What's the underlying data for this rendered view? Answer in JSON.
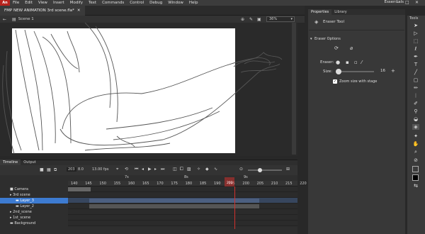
{
  "menu": {
    "logo": "An",
    "items": [
      "File",
      "Edit",
      "View",
      "Insert",
      "Modify",
      "Text",
      "Commands",
      "Control",
      "Debug",
      "Window",
      "Help"
    ],
    "workspace": "Essentials"
  },
  "document": {
    "tab": "FMP NEW ANIMATION 3rd scene.fla*",
    "scene": "Scene 1",
    "zoom": "36%"
  },
  "timeline": {
    "tabs": [
      "Timeline",
      "Output"
    ],
    "fps": "13.00 fps",
    "frame": "203",
    "time": "8.0",
    "ruler": [
      "140",
      "145",
      "150",
      "155",
      "160",
      "165",
      "170",
      "175",
      "180",
      "185",
      "190",
      "195",
      "200",
      "205",
      "210",
      "215",
      "220"
    ],
    "seconds": [
      "7s",
      "8s",
      "9s"
    ],
    "playhead": "203",
    "layers": [
      {
        "name": "Camera",
        "type": "camera"
      },
      {
        "name": "3rd scene",
        "type": "folder"
      },
      {
        "name": "Layer_3",
        "type": "layer",
        "selected": true
      },
      {
        "name": "Layer_2",
        "type": "layer"
      },
      {
        "name": "2nd_scene",
        "type": "folder"
      },
      {
        "name": "1st_scene",
        "type": "folder"
      },
      {
        "name": "Background",
        "type": "layer"
      }
    ]
  },
  "properties": {
    "tabs": [
      "Properties",
      "Library"
    ],
    "tool": "Eraser Tool",
    "section": "Eraser Options",
    "eraser_label": "Eraser:",
    "size_label": "Size:",
    "size_value": "16",
    "zoom_checkbox": "Zoom size with stage"
  },
  "tools_title": "Tools",
  "colors": {
    "accent": "#3d7bd1",
    "playhead": "#d0312d",
    "logo": "#b8231d"
  }
}
